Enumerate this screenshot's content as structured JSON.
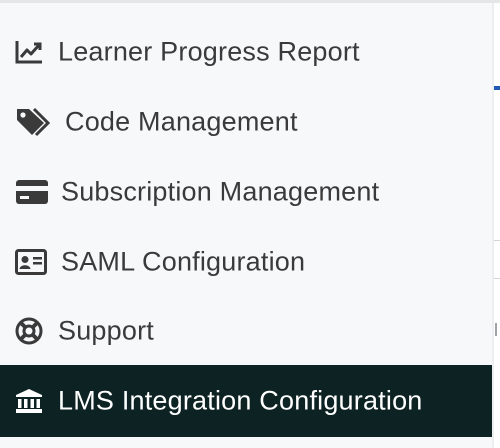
{
  "sidebar": {
    "items": [
      {
        "label": "Learner Progress Report",
        "icon": "line-chart-icon",
        "active": false
      },
      {
        "label": "Code Management",
        "icon": "tags-icon",
        "active": false
      },
      {
        "label": "Subscription Management",
        "icon": "credit-card-icon",
        "active": false
      },
      {
        "label": "SAML Configuration",
        "icon": "id-card-icon",
        "active": false
      },
      {
        "label": "Support",
        "icon": "life-ring-icon",
        "active": false
      },
      {
        "label": "LMS Integration Configuration",
        "icon": "university-icon",
        "active": true
      }
    ]
  },
  "colors": {
    "sidebar_background": "#f7f8fa",
    "active_background": "#0d2223",
    "text": "#3a3a3a",
    "active_text": "#ffffff",
    "accent": "#1f5bb5"
  }
}
